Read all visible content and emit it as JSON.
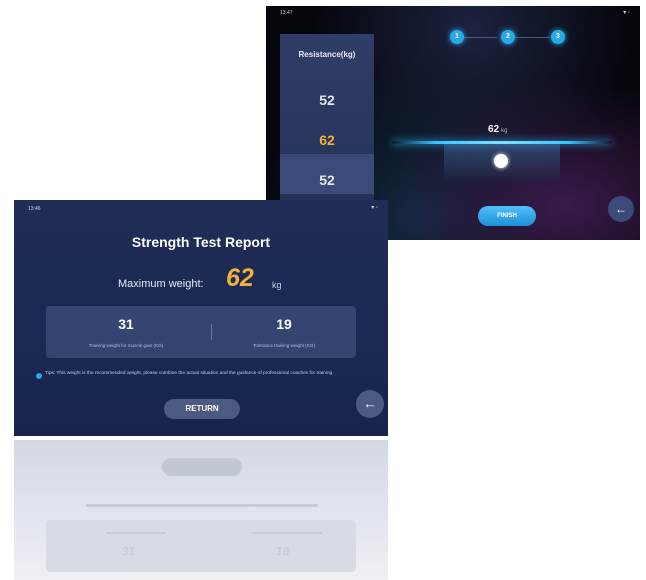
{
  "resistance_screen": {
    "time": "13:47",
    "status_icons": "▾ ◦",
    "panel_title": "Resistance(kg)",
    "values": [
      "52",
      "62",
      "52"
    ],
    "selected_index": 1,
    "steps": [
      "1",
      "2",
      "3"
    ],
    "current_weight": "62",
    "weight_unit": "kg",
    "finish_label": "FINISH",
    "back_icon": "arrow-left-icon",
    "accent_color": "#2aa8e8"
  },
  "report_screen": {
    "time": "13:46",
    "status_icons": "▾ ◦",
    "title": "Strength Test Report",
    "max_label": "Maximum weight:",
    "max_value": "62",
    "max_unit": "kg",
    "stats": [
      {
        "value": "31",
        "label": "Training weight for muscle gain (KG)"
      },
      {
        "value": "19",
        "label": "Tolerance training weight (KG)"
      }
    ],
    "tip": "Tips: This weight is the recommended weight, please combine the actual situation and the guidance of professional coaches for training",
    "return_label": "RETURN",
    "back_icon": "arrow-left-icon",
    "value_color": "#f2b138"
  }
}
